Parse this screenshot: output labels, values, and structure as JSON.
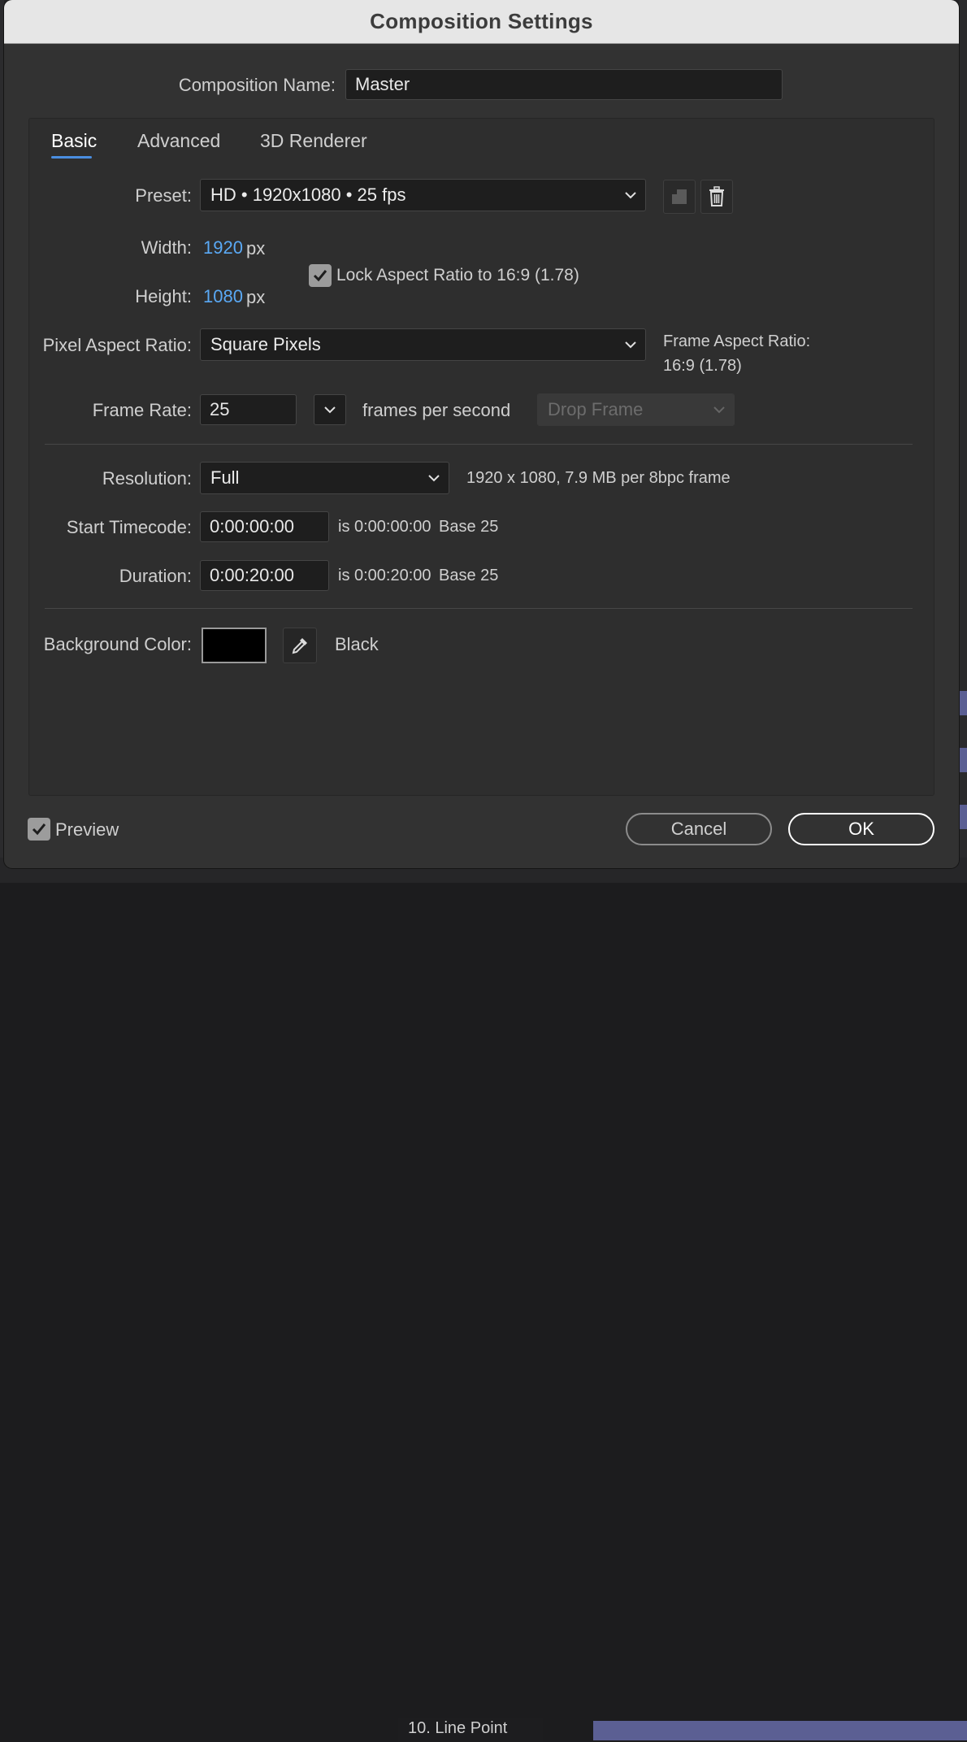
{
  "dialog": {
    "title": "Composition Settings",
    "composition_name_label": "Composition Name:",
    "composition_name_value": "Master"
  },
  "tabs": [
    {
      "label": "Basic",
      "active": true
    },
    {
      "label": "Advanced",
      "active": false
    },
    {
      "label": "3D Renderer",
      "active": false
    }
  ],
  "basic": {
    "preset_label": "Preset:",
    "preset_value": "HD  •  1920x1080 • 25 fps",
    "width_label": "Width:",
    "width_value": "1920",
    "height_label": "Height:",
    "height_value": "1080",
    "px_unit": "px",
    "lock_aspect_label": "Lock Aspect Ratio to 16:9 (1.78)",
    "lock_aspect_checked": true,
    "pixel_aspect_label": "Pixel Aspect Ratio:",
    "pixel_aspect_value": "Square Pixels",
    "frame_aspect_label": "Frame Aspect Ratio:",
    "frame_aspect_value": "16:9 (1.78)",
    "frame_rate_label": "Frame Rate:",
    "frame_rate_value": "25",
    "frame_rate_unit": "frames per second",
    "drop_frame_value": "Drop Frame",
    "resolution_label": "Resolution:",
    "resolution_value": "Full",
    "resolution_info": "1920 x 1080, 7.9 MB per 8bpc frame",
    "start_timecode_label": "Start Timecode:",
    "start_timecode_value": "0:00:00:00",
    "start_timecode_is": "is 0:00:00:00",
    "start_timecode_base": "Base 25",
    "duration_label": "Duration:",
    "duration_value": "0:00:20:00",
    "duration_is": "is 0:00:20:00",
    "duration_base": "Base 25",
    "background_color_label": "Background Color:",
    "background_color_name": "Black",
    "background_color_hex": "#000000"
  },
  "footer": {
    "preview_label": "Preview",
    "preview_checked": true,
    "cancel_label": "Cancel",
    "ok_label": "OK"
  },
  "background_app": {
    "layer_name": "10. Line Point"
  },
  "colors": {
    "accent_blue": "#5aa9f5",
    "tab_underline": "#4a8ee0",
    "timeline_purple": "#5b5f93"
  }
}
